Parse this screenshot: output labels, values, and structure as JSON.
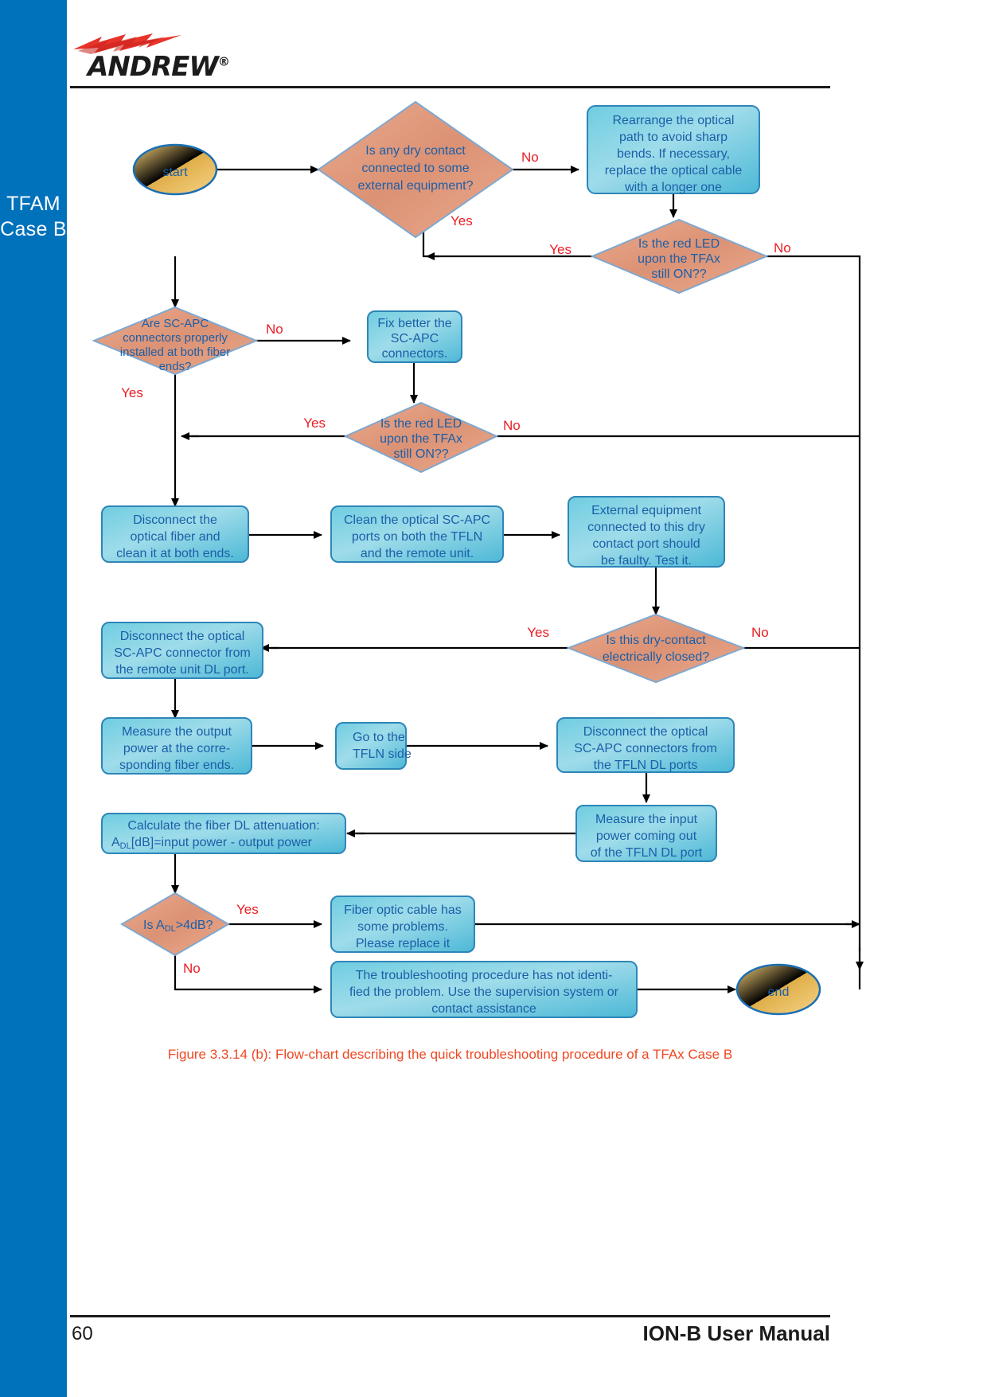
{
  "page": {
    "number": "60",
    "manual_title": "ION-B User Manual",
    "sidebar_line1": "TFAM",
    "sidebar_line2": "Case B",
    "logo_text": "ANDREW",
    "logo_registered": "®",
    "caption": "Figure 3.3.14 (b): Flow-chart describing the quick troubleshooting procedure of a TFAx Case B"
  },
  "colors": {
    "sidebar_blue": "#0072bc",
    "node_blue_fill": "#58c3de",
    "node_blue_stroke": "#2e86b8",
    "decision_fill": "#e8a183",
    "decision_stroke": "#7fa8d0",
    "terminal_fill": "#f5c44a",
    "terminal_stroke": "#1b6fb5",
    "node_text": "#1b5fa8",
    "edge_label": "#ec1c24",
    "caption": "#ef4823",
    "line": "#000000"
  },
  "chart_data": {
    "type": "diagram",
    "title": "Flow-chart describing the quick troubleshooting procedure of a TFAx Case B",
    "nodes": [
      {
        "id": "start",
        "shape": "terminal",
        "label": "start"
      },
      {
        "id": "dry_contact",
        "shape": "decision",
        "label": "Is any dry contact connected to some external equipment?",
        "lines": [
          "Is any dry contact",
          "connected to some",
          "external equipment?"
        ]
      },
      {
        "id": "rearrange",
        "shape": "process",
        "label": "Rearrange the optical path to avoid sharp bends. If necessary, replace the optical cable with a longer one",
        "lines": [
          "Rearrange the optical",
          "path to avoid sharp",
          "bends. If necessary,",
          "replace the optical cable",
          "with a longer one"
        ]
      },
      {
        "id": "led1",
        "shape": "decision",
        "label": "Is the red LED upon the TFAx still ON??",
        "lines": [
          "Is the red LED",
          "upon the TFAx",
          "still ON??"
        ]
      },
      {
        "id": "scapc",
        "shape": "decision",
        "label": "Are SC-APC connectors properly installed at both fiber ends?",
        "lines": [
          "Are SC-APC",
          "connectors properly",
          "installed at both fiber",
          "ends?"
        ]
      },
      {
        "id": "fixbetter",
        "shape": "process",
        "label": "Fix better the SC-APC connectors.",
        "lines": [
          "Fix better the",
          "SC-APC",
          "connectors."
        ]
      },
      {
        "id": "led2",
        "shape": "decision",
        "label": "Is the red LED upon the TFAx still ON??",
        "lines": [
          "Is the red LED",
          "upon the TFAx",
          "still ON??"
        ]
      },
      {
        "id": "disc_fiber",
        "shape": "process",
        "label": "Disconnect the optical fiber and clean it at both ends.",
        "lines": [
          "Disconnect the",
          "optical fiber and",
          "clean it at both ends."
        ]
      },
      {
        "id": "clean_ports",
        "shape": "process",
        "label": "Clean the optical SC-APC ports on both the TFLN and the remote unit.",
        "lines": [
          "Clean the optical SC-APC",
          "ports on both the TFLN",
          "and the remote unit."
        ]
      },
      {
        "id": "ext_equip",
        "shape": "process",
        "label": "External equipment connected to this dry contact port should be faulty. Test it.",
        "lines": [
          "External equipment",
          "connected to this dry",
          "contact port should",
          "be faulty. Test it."
        ]
      },
      {
        "id": "dry_closed",
        "shape": "decision",
        "label": "Is this dry-contact electrically closed?",
        "lines": [
          "Is this dry-contact",
          "electrically closed?"
        ]
      },
      {
        "id": "disc_remote",
        "shape": "process",
        "label": "Disconnect the optical SC-APC connector from the remote unit DL port.",
        "lines": [
          "Disconnect the optical",
          "SC-APC connector from",
          "the remote unit DL port."
        ]
      },
      {
        "id": "measure_out",
        "shape": "process",
        "label": "Measure the output power at the corre-sponding fiber ends.",
        "lines": [
          "Measure the output",
          "power at the corre-",
          "sponding fiber ends."
        ]
      },
      {
        "id": "goto_tfln",
        "shape": "process",
        "label": "Go to the TFLN side",
        "lines": [
          "Go to the",
          "TFLN side"
        ]
      },
      {
        "id": "disc_tfln",
        "shape": "process",
        "label": "Disconnect the optical SC-APC connectors from the TFLN DL ports",
        "lines": [
          "Disconnect the optical",
          "SC-APC connectors from",
          "the TFLN DL ports"
        ]
      },
      {
        "id": "measure_in",
        "shape": "process",
        "label": "Measure the input power coming out of the TFLN DL port",
        "lines": [
          "Measure the input",
          "power coming out",
          "of the TFLN DL port"
        ]
      },
      {
        "id": "calc_att",
        "shape": "process",
        "label": "Calculate the fiber DL attenuation: ADL[dB]=input power - output power",
        "lines": [
          "Calculate the fiber DL attenuation:",
          "ADL[dB]=input power - output power"
        ],
        "line2_prefix": "A",
        "line2_sub": "DL",
        "line2_rest": "[dB]=input power - output power"
      },
      {
        "id": "att_gt4",
        "shape": "decision",
        "label": "Is ADL>4dB?",
        "prefix": "Is A",
        "sub": "DL",
        "rest": ">4dB?"
      },
      {
        "id": "fiber_bad",
        "shape": "process",
        "label": "Fiber optic cable has some problems. Please replace it",
        "lines": [
          "Fiber optic cable has",
          "some problems.",
          "Please replace it"
        ]
      },
      {
        "id": "not_ident",
        "shape": "process",
        "label": "The troubleshooting procedure has not identified the problem. Use the supervision system or contact assistance",
        "lines": [
          "The troubleshooting procedure has not identi-",
          "fied the problem. Use the supervision system or",
          "contact assistance"
        ]
      },
      {
        "id": "end",
        "shape": "terminal",
        "label": "end"
      }
    ],
    "edges": [
      {
        "from": "start",
        "to": "dry_contact",
        "label": ""
      },
      {
        "from": "dry_contact",
        "to": "rearrange",
        "label": "No"
      },
      {
        "from": "dry_contact",
        "to": "scapc",
        "label": "Yes"
      },
      {
        "from": "rearrange",
        "to": "led1",
        "label": ""
      },
      {
        "from": "led1",
        "to": "scapc",
        "label": "Yes"
      },
      {
        "from": "led1",
        "to": "end",
        "label": "No"
      },
      {
        "from": "scapc",
        "to": "fixbetter",
        "label": "No"
      },
      {
        "from": "scapc",
        "to": "disc_fiber",
        "label": "Yes"
      },
      {
        "from": "fixbetter",
        "to": "led2",
        "label": ""
      },
      {
        "from": "led2",
        "to": "disc_fiber",
        "label": "Yes"
      },
      {
        "from": "led2",
        "to": "end",
        "label": "No"
      },
      {
        "from": "disc_fiber",
        "to": "clean_ports",
        "label": ""
      },
      {
        "from": "clean_ports",
        "to": "ext_equip",
        "label": ""
      },
      {
        "from": "ext_equip",
        "to": "dry_closed",
        "label": ""
      },
      {
        "from": "dry_closed",
        "to": "disc_remote",
        "label": "Yes"
      },
      {
        "from": "dry_closed",
        "to": "end",
        "label": "No"
      },
      {
        "from": "disc_remote",
        "to": "measure_out",
        "label": ""
      },
      {
        "from": "measure_out",
        "to": "goto_tfln",
        "label": ""
      },
      {
        "from": "goto_tfln",
        "to": "disc_tfln",
        "label": ""
      },
      {
        "from": "disc_tfln",
        "to": "measure_in",
        "label": ""
      },
      {
        "from": "measure_in",
        "to": "calc_att",
        "label": ""
      },
      {
        "from": "calc_att",
        "to": "att_gt4",
        "label": ""
      },
      {
        "from": "att_gt4",
        "to": "fiber_bad",
        "label": "Yes"
      },
      {
        "from": "att_gt4",
        "to": "not_ident",
        "label": "No"
      },
      {
        "from": "fiber_bad",
        "to": "end",
        "label": ""
      },
      {
        "from": "not_ident",
        "to": "end",
        "label": ""
      }
    ]
  },
  "labels": {
    "start": "start",
    "end": "end",
    "yes": "Yes",
    "no": "No",
    "dry_contact": [
      "Is any dry contact",
      "connected to some",
      "external equipment?"
    ],
    "rearrange": [
      "Rearrange the optical",
      "path to avoid sharp",
      "bends. If necessary,",
      "replace the optical cable",
      "with a longer one"
    ],
    "led1": [
      "Is the red LED",
      "upon the TFAx",
      "still ON??"
    ],
    "scapc": [
      "Are SC-APC",
      "connectors properly",
      "installed at both fiber",
      "ends?"
    ],
    "fixbetter": [
      "Fix better the",
      "SC-APC",
      "connectors."
    ],
    "led2": [
      "Is the red LED",
      "upon the TFAx",
      "still ON??"
    ],
    "disc_fiber": [
      "Disconnect the",
      "optical fiber and",
      "clean it at both ends."
    ],
    "clean_ports": [
      "Clean the optical SC-APC",
      "ports on both the TFLN",
      "and the remote unit."
    ],
    "ext_equip": [
      "External equipment",
      "connected to this dry",
      "contact port should",
      "be faulty. Test it."
    ],
    "dry_closed": [
      "Is this dry-contact",
      "electrically closed?"
    ],
    "disc_remote": [
      "Disconnect the optical",
      "SC-APC connector from",
      "the remote unit DL port."
    ],
    "measure_out": [
      "Measure the output",
      "power at the corre-",
      "sponding fiber ends."
    ],
    "goto_tfln": [
      "Go to the",
      "TFLN side"
    ],
    "disc_tfln": [
      "Disconnect the optical",
      "SC-APC connectors from",
      "the TFLN DL ports"
    ],
    "measure_in": [
      "Measure the input",
      "power coming out",
      "of the TFLN DL port"
    ],
    "calc_att_l1": "Calculate the fiber DL attenuation:",
    "calc_att_l2a": "A",
    "calc_att_l2b": "DL",
    "calc_att_l2c": "[dB]=input power - output power",
    "att_a": "Is A",
    "att_b": "DL",
    "att_c": ">4dB?",
    "fiber_bad": [
      "Fiber optic cable has",
      "some problems.",
      "Please replace it"
    ],
    "not_ident": [
      "The troubleshooting procedure has not identi-",
      "fied the problem. Use the supervision system or",
      "contact assistance"
    ]
  }
}
